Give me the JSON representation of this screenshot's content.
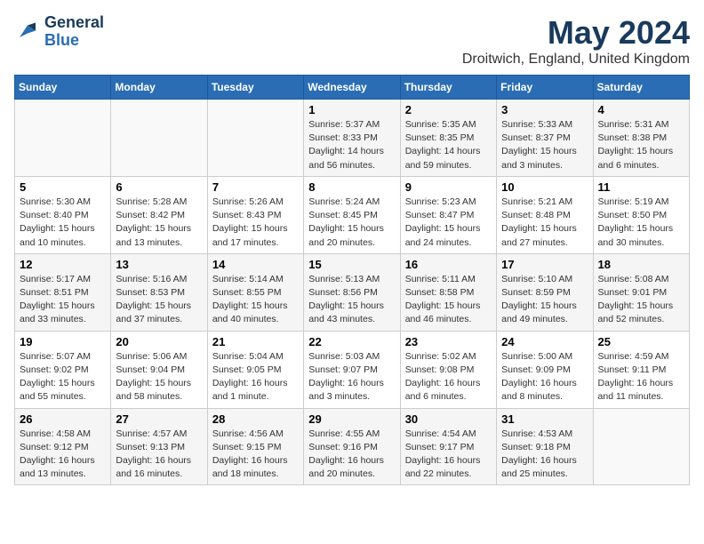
{
  "header": {
    "logo_line1": "General",
    "logo_line2": "Blue",
    "month": "May 2024",
    "location": "Droitwich, England, United Kingdom"
  },
  "weekdays": [
    "Sunday",
    "Monday",
    "Tuesday",
    "Wednesday",
    "Thursday",
    "Friday",
    "Saturday"
  ],
  "weeks": [
    [
      {
        "day": "",
        "info": ""
      },
      {
        "day": "",
        "info": ""
      },
      {
        "day": "",
        "info": ""
      },
      {
        "day": "1",
        "info": "Sunrise: 5:37 AM\nSunset: 8:33 PM\nDaylight: 14 hours\nand 56 minutes."
      },
      {
        "day": "2",
        "info": "Sunrise: 5:35 AM\nSunset: 8:35 PM\nDaylight: 14 hours\nand 59 minutes."
      },
      {
        "day": "3",
        "info": "Sunrise: 5:33 AM\nSunset: 8:37 PM\nDaylight: 15 hours\nand 3 minutes."
      },
      {
        "day": "4",
        "info": "Sunrise: 5:31 AM\nSunset: 8:38 PM\nDaylight: 15 hours\nand 6 minutes."
      }
    ],
    [
      {
        "day": "5",
        "info": "Sunrise: 5:30 AM\nSunset: 8:40 PM\nDaylight: 15 hours\nand 10 minutes."
      },
      {
        "day": "6",
        "info": "Sunrise: 5:28 AM\nSunset: 8:42 PM\nDaylight: 15 hours\nand 13 minutes."
      },
      {
        "day": "7",
        "info": "Sunrise: 5:26 AM\nSunset: 8:43 PM\nDaylight: 15 hours\nand 17 minutes."
      },
      {
        "day": "8",
        "info": "Sunrise: 5:24 AM\nSunset: 8:45 PM\nDaylight: 15 hours\nand 20 minutes."
      },
      {
        "day": "9",
        "info": "Sunrise: 5:23 AM\nSunset: 8:47 PM\nDaylight: 15 hours\nand 24 minutes."
      },
      {
        "day": "10",
        "info": "Sunrise: 5:21 AM\nSunset: 8:48 PM\nDaylight: 15 hours\nand 27 minutes."
      },
      {
        "day": "11",
        "info": "Sunrise: 5:19 AM\nSunset: 8:50 PM\nDaylight: 15 hours\nand 30 minutes."
      }
    ],
    [
      {
        "day": "12",
        "info": "Sunrise: 5:17 AM\nSunset: 8:51 PM\nDaylight: 15 hours\nand 33 minutes."
      },
      {
        "day": "13",
        "info": "Sunrise: 5:16 AM\nSunset: 8:53 PM\nDaylight: 15 hours\nand 37 minutes."
      },
      {
        "day": "14",
        "info": "Sunrise: 5:14 AM\nSunset: 8:55 PM\nDaylight: 15 hours\nand 40 minutes."
      },
      {
        "day": "15",
        "info": "Sunrise: 5:13 AM\nSunset: 8:56 PM\nDaylight: 15 hours\nand 43 minutes."
      },
      {
        "day": "16",
        "info": "Sunrise: 5:11 AM\nSunset: 8:58 PM\nDaylight: 15 hours\nand 46 minutes."
      },
      {
        "day": "17",
        "info": "Sunrise: 5:10 AM\nSunset: 8:59 PM\nDaylight: 15 hours\nand 49 minutes."
      },
      {
        "day": "18",
        "info": "Sunrise: 5:08 AM\nSunset: 9:01 PM\nDaylight: 15 hours\nand 52 minutes."
      }
    ],
    [
      {
        "day": "19",
        "info": "Sunrise: 5:07 AM\nSunset: 9:02 PM\nDaylight: 15 hours\nand 55 minutes."
      },
      {
        "day": "20",
        "info": "Sunrise: 5:06 AM\nSunset: 9:04 PM\nDaylight: 15 hours\nand 58 minutes."
      },
      {
        "day": "21",
        "info": "Sunrise: 5:04 AM\nSunset: 9:05 PM\nDaylight: 16 hours\nand 1 minute."
      },
      {
        "day": "22",
        "info": "Sunrise: 5:03 AM\nSunset: 9:07 PM\nDaylight: 16 hours\nand 3 minutes."
      },
      {
        "day": "23",
        "info": "Sunrise: 5:02 AM\nSunset: 9:08 PM\nDaylight: 16 hours\nand 6 minutes."
      },
      {
        "day": "24",
        "info": "Sunrise: 5:00 AM\nSunset: 9:09 PM\nDaylight: 16 hours\nand 8 minutes."
      },
      {
        "day": "25",
        "info": "Sunrise: 4:59 AM\nSunset: 9:11 PM\nDaylight: 16 hours\nand 11 minutes."
      }
    ],
    [
      {
        "day": "26",
        "info": "Sunrise: 4:58 AM\nSunset: 9:12 PM\nDaylight: 16 hours\nand 13 minutes."
      },
      {
        "day": "27",
        "info": "Sunrise: 4:57 AM\nSunset: 9:13 PM\nDaylight: 16 hours\nand 16 minutes."
      },
      {
        "day": "28",
        "info": "Sunrise: 4:56 AM\nSunset: 9:15 PM\nDaylight: 16 hours\nand 18 minutes."
      },
      {
        "day": "29",
        "info": "Sunrise: 4:55 AM\nSunset: 9:16 PM\nDaylight: 16 hours\nand 20 minutes."
      },
      {
        "day": "30",
        "info": "Sunrise: 4:54 AM\nSunset: 9:17 PM\nDaylight: 16 hours\nand 22 minutes."
      },
      {
        "day": "31",
        "info": "Sunrise: 4:53 AM\nSunset: 9:18 PM\nDaylight: 16 hours\nand 25 minutes."
      },
      {
        "day": "",
        "info": ""
      }
    ]
  ]
}
